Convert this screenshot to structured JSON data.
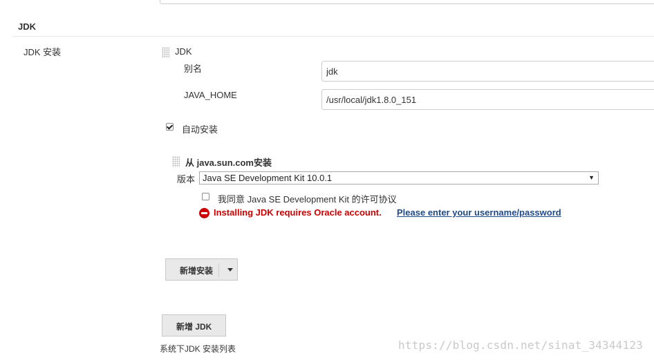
{
  "section": {
    "title": "JDK"
  },
  "jdk_install": {
    "label": "JDK 安装",
    "block_title": "JDK",
    "alias_label": "别名",
    "alias_value": "jdk",
    "java_home_label": "JAVA_HOME",
    "java_home_value": "/usr/local/jdk1.8.0_151",
    "auto_install_label": "自动安装",
    "auto_install_checked": true
  },
  "installer": {
    "title": "从 java.sun.com安装",
    "version_label": "版本",
    "version_value": "Java SE Development Kit 10.0.1",
    "agree_label": "我同意 Java SE Development Kit 的许可协议",
    "agree_checked": false,
    "error_text": "Installing JDK requires Oracle account.",
    "error_link": "Please enter your username/password"
  },
  "buttons": {
    "add_installer": "新增安装",
    "add_jdk": "新增 JDK"
  },
  "footer": {
    "list_caption": "系统下JDK 安装列表"
  },
  "watermark": "https://blog.csdn.net/sinat_34344123",
  "colors": {
    "error": "#cc0000",
    "link": "#204a87",
    "button_bg": "#e9e9e9"
  }
}
